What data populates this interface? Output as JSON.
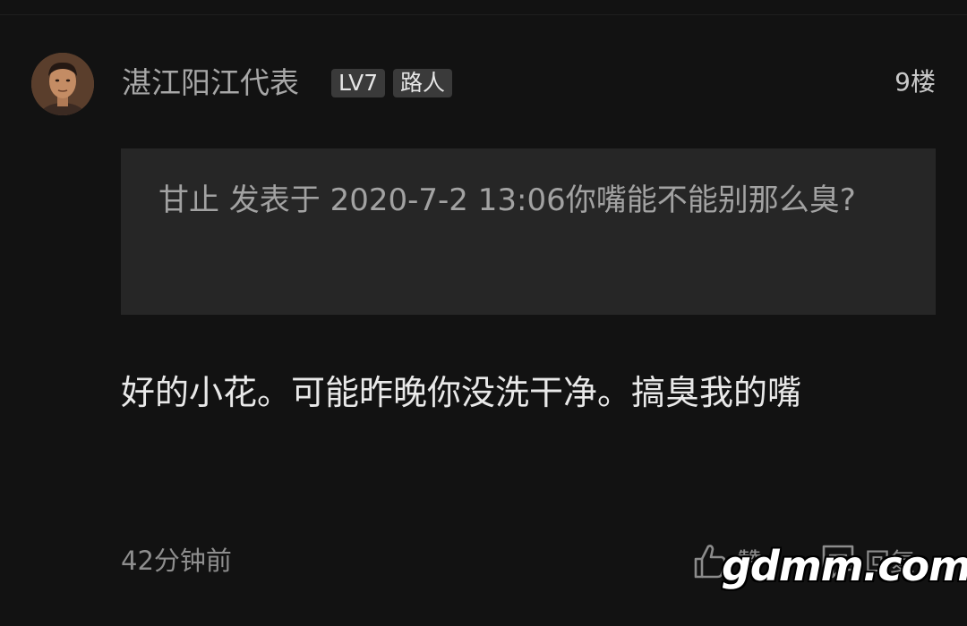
{
  "user": {
    "name": "湛江阳江代表",
    "level_badge": "LV7",
    "title_badge": "路人"
  },
  "floor": "9楼",
  "quote": {
    "text": "甘止 发表于 2020-7-2 13:06你嘴能不能别那么臭?"
  },
  "comment": {
    "text": "好的小花。可能昨晚你没洗干净。搞臭我的嘴"
  },
  "footer": {
    "time": "42分钟前",
    "like_label": "赞",
    "reply_label": "回复",
    "like_icon": "thumbs-up-icon",
    "reply_icon": "comment-icon"
  },
  "watermark": "gdmm.com",
  "colors": {
    "background": "#121212",
    "quote_background": "#262626",
    "badge_background": "#3a3a3a",
    "body_text": "#e9e9e9",
    "muted_text": "#8e8e8e"
  }
}
